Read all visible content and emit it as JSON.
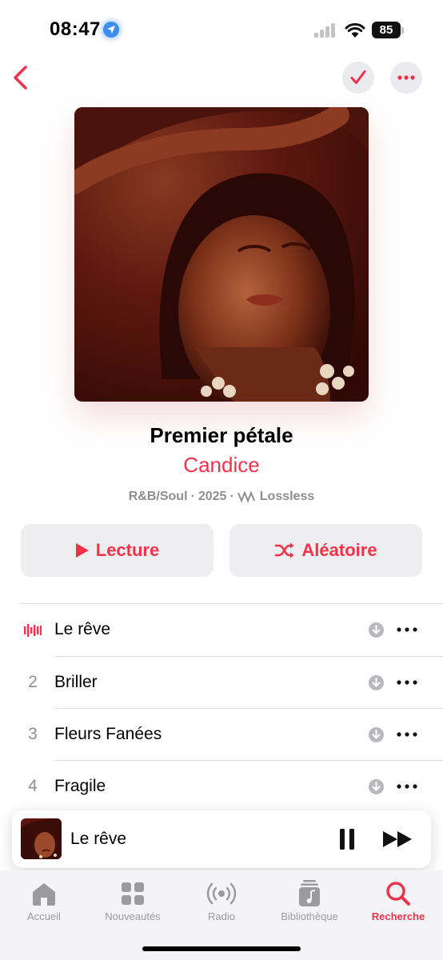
{
  "status_bar": {
    "time": "08:47",
    "battery": "85"
  },
  "album": {
    "title": "Premier pétale",
    "artist": "Candice",
    "genre": "R&B/Soul",
    "year": "2025",
    "quality": "Lossless",
    "separator": "·"
  },
  "actions": {
    "play_label": "Lecture",
    "shuffle_label": "Aléatoire"
  },
  "tracks": [
    {
      "number": "",
      "title": "Le rêve",
      "playing": true
    },
    {
      "number": "2",
      "title": "Briller",
      "playing": false
    },
    {
      "number": "3",
      "title": "Fleurs Fanées",
      "playing": false
    },
    {
      "number": "4",
      "title": "Fragile",
      "playing": false
    }
  ],
  "mini_player": {
    "title": "Le rêve"
  },
  "tab_bar": {
    "items": [
      {
        "label": "Accueil",
        "icon": "home-icon"
      },
      {
        "label": "Nouveautés",
        "icon": "grid-icon"
      },
      {
        "label": "Radio",
        "icon": "radio-icon"
      },
      {
        "label": "Bibliothèque",
        "icon": "library-icon"
      },
      {
        "label": "Recherche",
        "icon": "search-icon",
        "active": true
      }
    ]
  },
  "colors": {
    "accent": "#f0334a",
    "secondary_text": "#8e8e93",
    "button_bg": "#eeeef0"
  }
}
